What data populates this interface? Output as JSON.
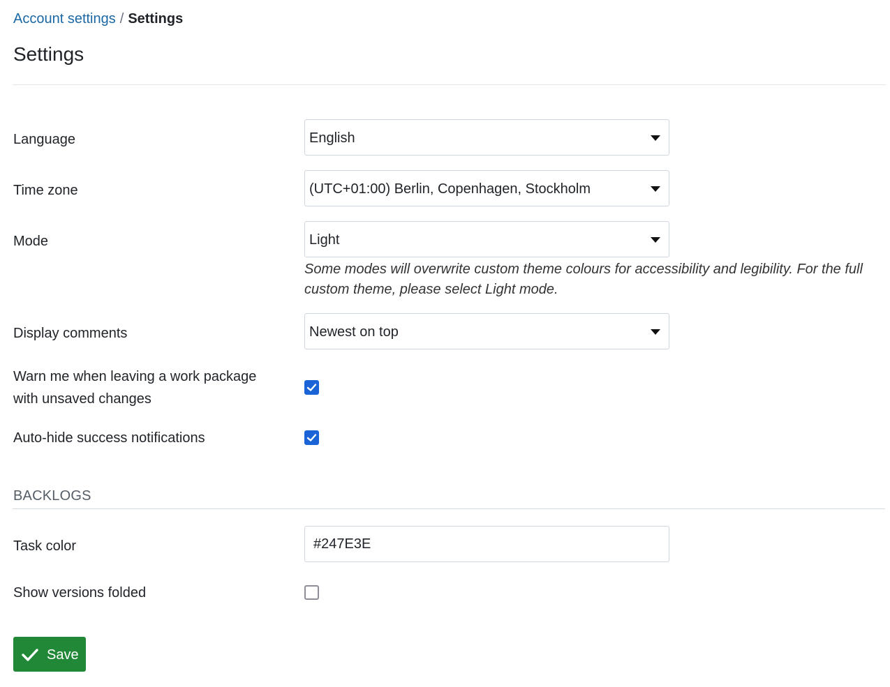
{
  "breadcrumb": {
    "parent": "Account settings",
    "separator": "/",
    "current": "Settings"
  },
  "page": {
    "title": "Settings"
  },
  "form": {
    "language": {
      "label": "Language",
      "value": "English"
    },
    "time_zone": {
      "label": "Time zone",
      "value": "(UTC+01:00) Berlin, Copenhagen, Stockholm"
    },
    "mode": {
      "label": "Mode",
      "value": "Light",
      "help": "Some modes will overwrite custom theme colours for accessibility and legibility. For the full custom theme, please select Light mode."
    },
    "display_comments": {
      "label": "Display comments",
      "value": "Newest on top"
    },
    "warn_unsaved": {
      "label_line1": "Warn me when leaving a work package",
      "label_line2": "with unsaved changes",
      "checked": true
    },
    "auto_hide": {
      "label": "Auto-hide success notifications",
      "checked": true
    }
  },
  "backlogs": {
    "header": "BACKLOGS",
    "task_color": {
      "label": "Task color",
      "value": "#247E3E"
    },
    "show_versions_folded": {
      "label": "Show versions folded",
      "checked": false
    }
  },
  "actions": {
    "save_label": "Save",
    "save_icon": "checkmark-icon"
  },
  "colors": {
    "link": "#1a67a3",
    "checkbox_checked": "#1a64d8",
    "save_button": "#218838"
  }
}
